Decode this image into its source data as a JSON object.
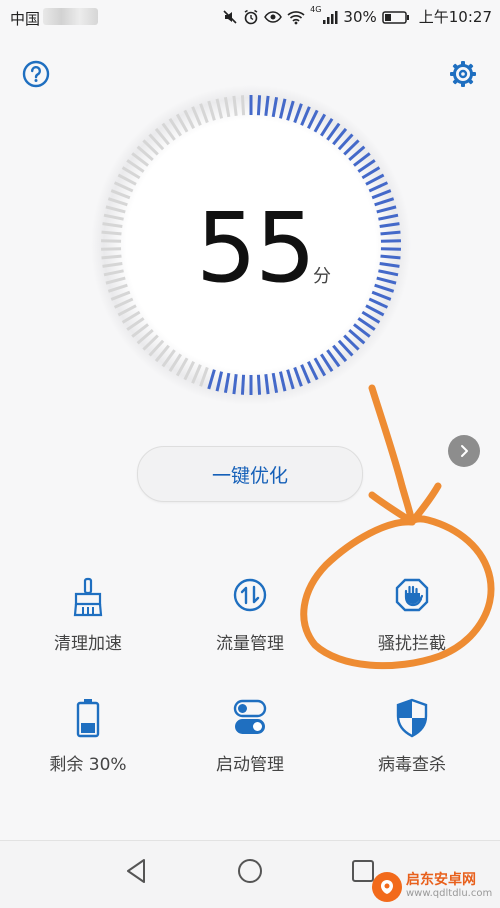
{
  "status_bar": {
    "carrier": "中国",
    "battery_percent": "30%",
    "time": "上午10:27",
    "network_badge": "4G"
  },
  "header": {
    "help_icon": "question-circle-icon",
    "settings_icon": "gear-icon"
  },
  "score": {
    "value": "55",
    "unit": "分",
    "fraction": 0.55
  },
  "optimize_button": {
    "label": "一键优化"
  },
  "tools": [
    {
      "id": "cleanup",
      "label": "清理加速",
      "icon": "broom-icon"
    },
    {
      "id": "traffic",
      "label": "流量管理",
      "icon": "data-traffic-icon"
    },
    {
      "id": "block",
      "label": "骚扰拦截",
      "icon": "hand-block-icon"
    },
    {
      "id": "battery",
      "label": "剩余 30%",
      "icon": "battery-icon"
    },
    {
      "id": "startup",
      "label": "启动管理",
      "icon": "toggle-icon"
    },
    {
      "id": "virus",
      "label": "病毒查杀",
      "icon": "shield-icon"
    }
  ],
  "colors": {
    "accent": "#1f6fc0",
    "gauge_active": "#4469c9",
    "gauge_inactive": "#d6d6d6",
    "annotation": "#ee8c33"
  },
  "watermark": {
    "title": "启东安卓网",
    "url": "www.qdltdlu.com"
  }
}
